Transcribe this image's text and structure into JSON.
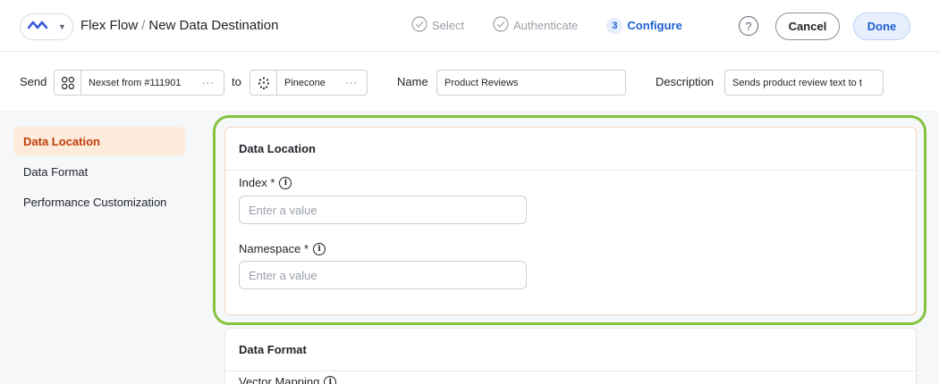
{
  "header": {
    "app_name": "Flex Flow",
    "separator": "/",
    "page_title": "New Data Destination",
    "steps": [
      {
        "label": "Select",
        "state": "completed",
        "icon": "check-circle-icon"
      },
      {
        "label": "Authenticate",
        "state": "completed",
        "icon": "check-circle-icon"
      },
      {
        "number": "3",
        "label": "Configure",
        "state": "active"
      }
    ],
    "help_symbol": "?",
    "cancel_label": "Cancel",
    "done_label": "Done"
  },
  "send_row": {
    "send_label": "Send",
    "source_value": "Nexset from #111901",
    "source_icon": "grid-icon",
    "to_label": "to",
    "destination_value": "Pinecone",
    "destination_icon": "pinecone-logo-icon",
    "more_symbol": "···",
    "name_label": "Name",
    "name_value": "Product Reviews",
    "description_label": "Description",
    "description_value": "Sends product review text to t"
  },
  "sidebar": {
    "items": [
      {
        "label": "Data Location",
        "active": true
      },
      {
        "label": "Data Format",
        "active": false
      },
      {
        "label": "Performance Customization",
        "active": false
      }
    ]
  },
  "sections": {
    "data_location": {
      "title": "Data Location",
      "fields": [
        {
          "label": "Index *",
          "placeholder": "Enter a value",
          "value": ""
        },
        {
          "label": "Namespace *",
          "placeholder": "Enter a value",
          "value": ""
        }
      ]
    },
    "data_format": {
      "title": "Data Format",
      "first_field_label": "Vector Mapping"
    }
  },
  "colors": {
    "accent_blue": "#1d5fd1",
    "active_nav_bg": "#fdebdc",
    "active_nav_text": "#c03d0a",
    "highlight_green": "#86c340"
  }
}
